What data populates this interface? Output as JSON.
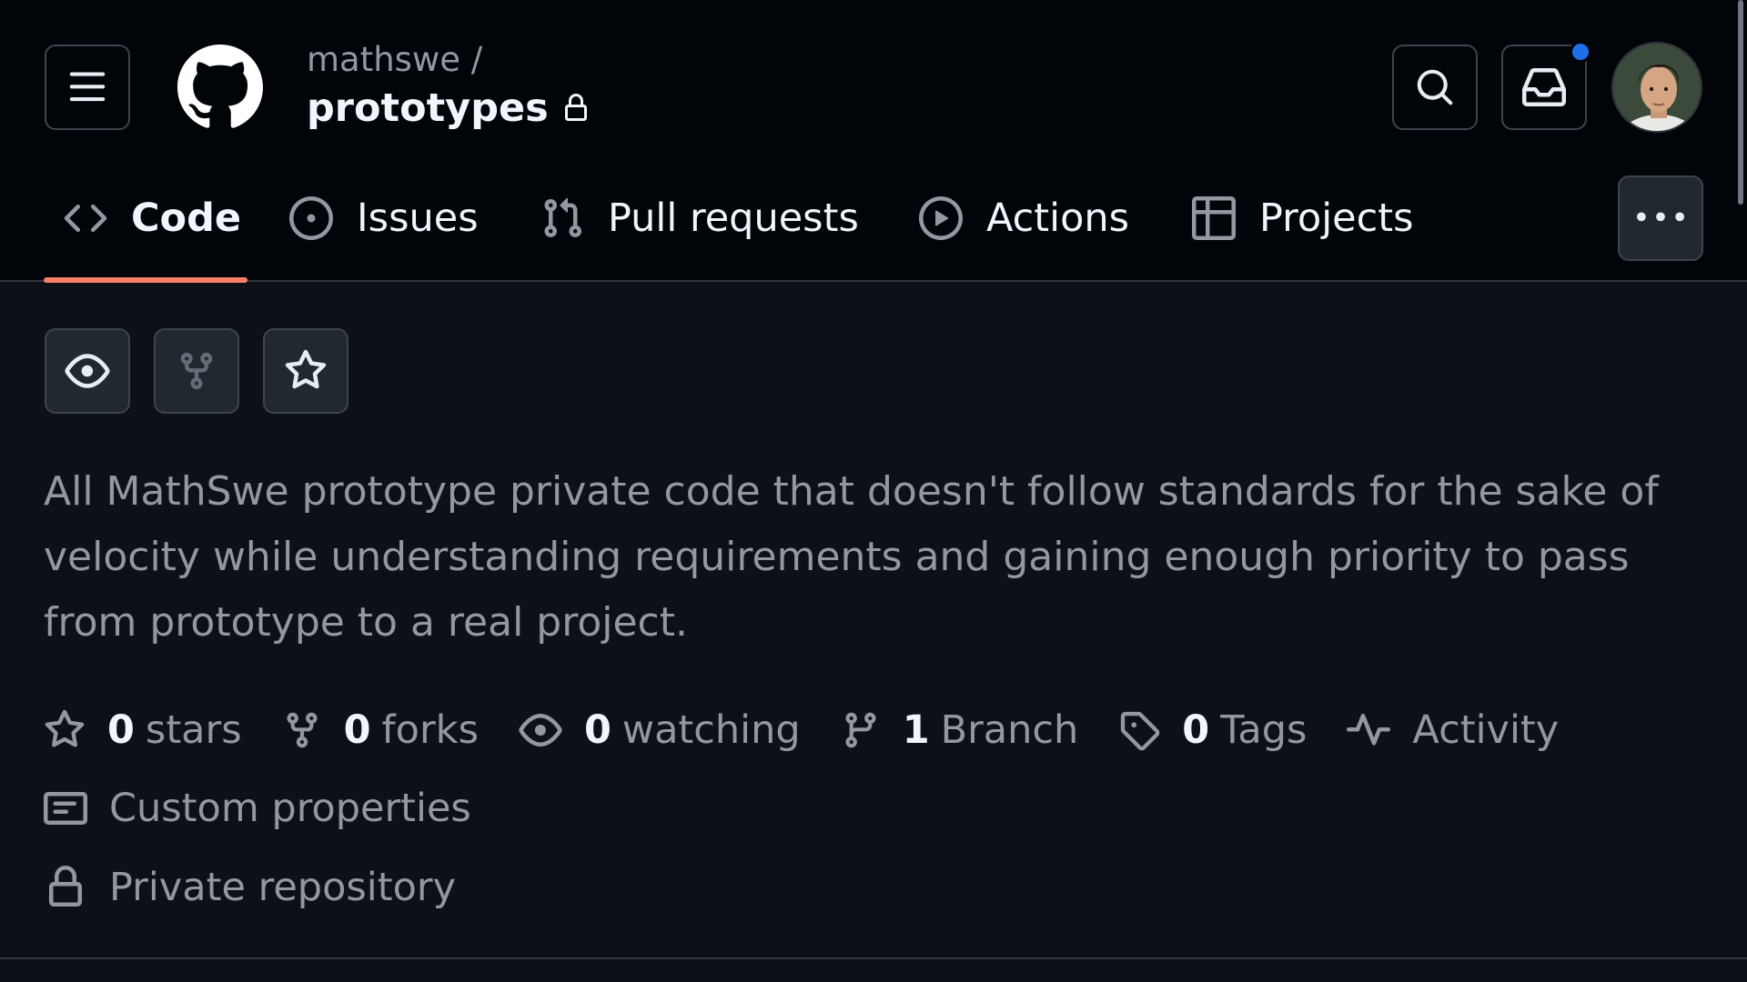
{
  "repo": {
    "owner": "mathswe /",
    "name": "prototypes",
    "visibility_icon": "lock-icon"
  },
  "header": {
    "menu_icon": "hamburger-icon",
    "logo": "github-mark",
    "search_icon": "search-icon",
    "inbox_icon": "inbox-icon",
    "has_notification": true,
    "notification_color": "#1f6feb"
  },
  "tabs": [
    {
      "label": "Code",
      "icon": "code-icon",
      "selected": true
    },
    {
      "label": "Issues",
      "icon": "issue-opened-icon",
      "selected": false
    },
    {
      "label": "Pull requests",
      "icon": "git-pull-request-icon",
      "selected": false
    },
    {
      "label": "Actions",
      "icon": "play-icon",
      "selected": false
    },
    {
      "label": "Projects",
      "icon": "table-icon",
      "selected": false
    }
  ],
  "more_button_icon": "kebab-horizontal-icon",
  "actions": {
    "watch_icon": "eye-icon",
    "fork_icon": "repo-forked-icon",
    "star_icon": "star-icon"
  },
  "description": "All MathSwe prototype private code that doesn't follow standards for the sake of velocity while understanding requirements and gaining enough priority to pass from prototype to a real project.",
  "stats": {
    "stars": {
      "count": "0",
      "label": "stars"
    },
    "forks": {
      "count": "0",
      "label": "forks"
    },
    "watching": {
      "count": "0",
      "label": "watching"
    },
    "branches": {
      "count": "1",
      "label": "Branch"
    },
    "tags": {
      "count": "0",
      "label": "Tags"
    },
    "activity": {
      "label": "Activity"
    }
  },
  "custom_properties_label": "Custom properties",
  "private_label": "Private repository",
  "colors": {
    "background": "#0d1117",
    "header_background": "#010409",
    "selected_tab_underline": "#f78166",
    "muted_text": "#9198a1",
    "primary_text": "#f0f6fc"
  }
}
